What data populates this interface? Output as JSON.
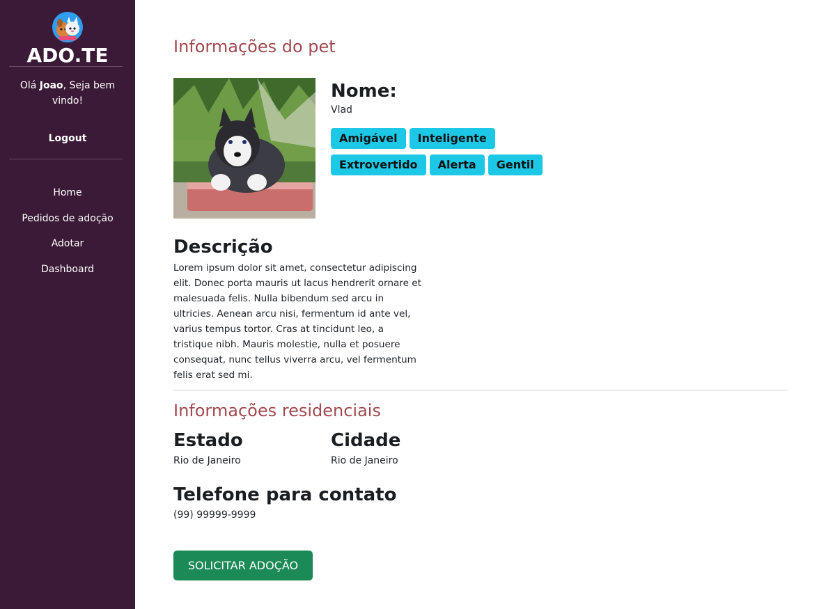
{
  "brand": {
    "name": "ADO.TE"
  },
  "sidebar": {
    "greeting_prefix": "Olá ",
    "username": "Joao",
    "greeting_suffix": ", Seja bem vindo!",
    "logout_label": "Logout",
    "nav": [
      {
        "label": "Home"
      },
      {
        "label": "Pedidos de adoção"
      },
      {
        "label": "Adotar"
      },
      {
        "label": "Dashboard"
      }
    ]
  },
  "pet": {
    "section_title": "Informações do pet",
    "name_label": "Nome:",
    "name": "Vlad",
    "tags": [
      "Amigável",
      "Inteligente",
      "Extrovertido",
      "Alerta",
      "Gentil"
    ],
    "description_label": "Descrição",
    "description": "Lorem ipsum dolor sit amet, consectetur adipiscing elit. Donec porta mauris ut lacus hendrerit ornare et malesuada felis. Nulla bibendum sed arcu in ultricies. Aenean arcu nisi, fermentum id ante vel, varius tempus tortor. Cras at tincidunt leo, a tristique nibh. Mauris molestie, nulla et posuere consequat, nunc tellus viverra arcu, vel fermentum felis erat sed mi."
  },
  "residence": {
    "section_title": "Informações residenciais",
    "state_label": "Estado",
    "state": "Rio de Janeiro",
    "city_label": "Cidade",
    "city": "Rio de Janeiro",
    "phone_label": "Telefone para contato",
    "phone": "(99) 99999-9999"
  },
  "actions": {
    "adopt_label": "SOLICITAR ADOÇÃO"
  },
  "colors": {
    "sidebar_bg": "#3a1a36",
    "section_title": "#a14a4f",
    "tag_bg": "#1cc8e6",
    "button_bg": "#1b8a56"
  }
}
